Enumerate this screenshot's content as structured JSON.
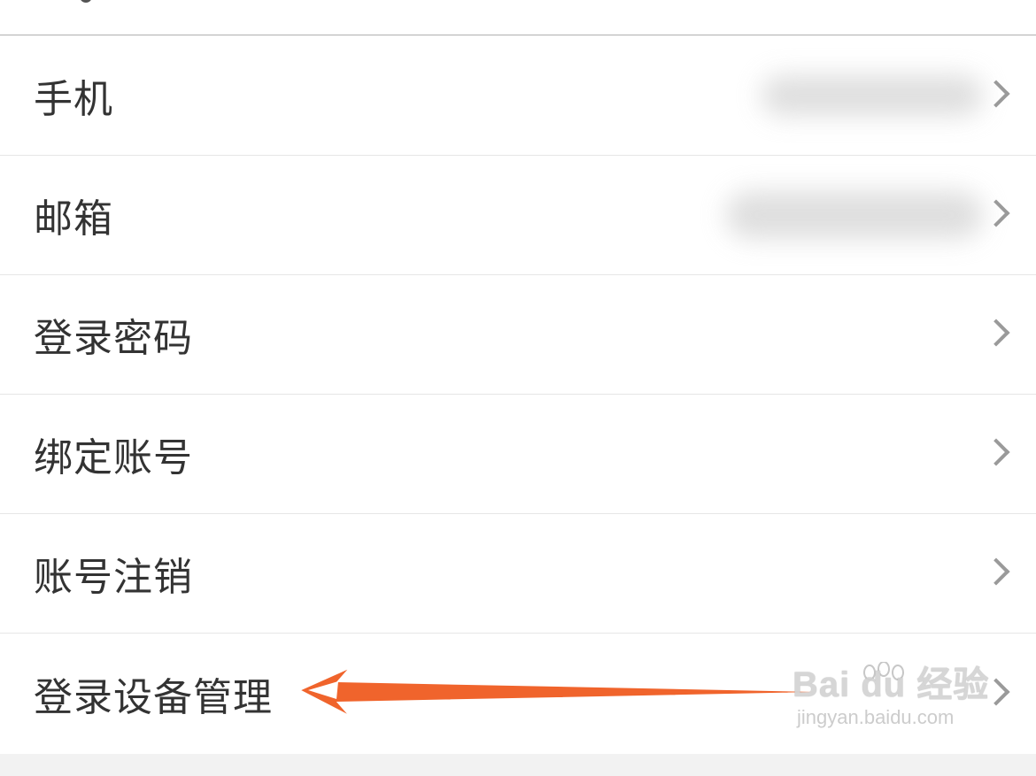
{
  "menu": {
    "items": [
      {
        "label": "手机",
        "value_blurred": true
      },
      {
        "label": "邮箱",
        "value_blurred": true
      },
      {
        "label": "登录密码"
      },
      {
        "label": "绑定账号"
      },
      {
        "label": "账号注销"
      },
      {
        "label": "登录设备管理"
      }
    ]
  },
  "icons": {
    "chevron": "chevron-right-icon",
    "annotation": "orange-arrow",
    "watermark": "paw-icon"
  },
  "watermark": {
    "brand": "Bai du 经验",
    "url": "jingyan.baidu.com"
  },
  "colors": {
    "background": "#f2f2f2",
    "row": "#ffffff",
    "text": "#333333",
    "chevron": "#9a9a9a",
    "arrow": "#f0642c"
  }
}
